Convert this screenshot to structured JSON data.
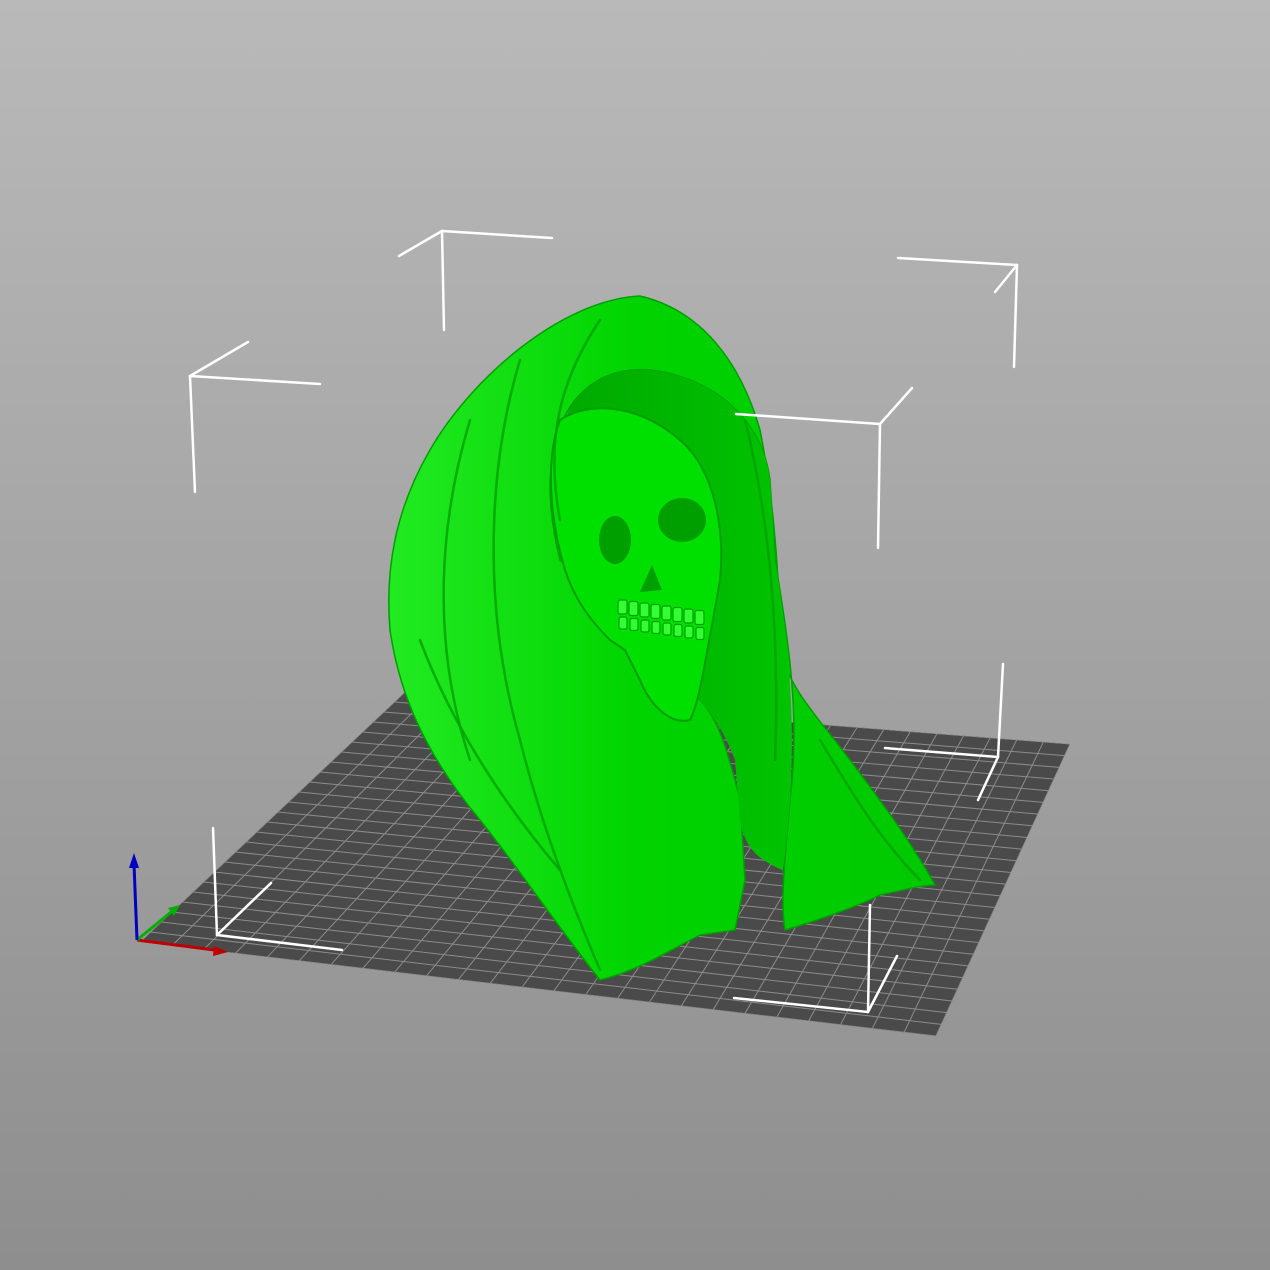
{
  "viewport": {
    "background_top": "#b9b9b9",
    "background_bottom": "#8e8e8e"
  },
  "build_plate": {
    "color": "#4a4a4a",
    "grid_line_color": "#8c8c8c"
  },
  "model": {
    "name": "hooded-skull-model",
    "color": "#00e000",
    "shadow_color": "#009f00",
    "highlight_color": "#33ff33",
    "selected": true
  },
  "bounding_box": {
    "color": "#ffffff"
  },
  "axes": {
    "x_color": "#c00000",
    "y_color": "#00b000",
    "z_color": "#0000c0"
  }
}
